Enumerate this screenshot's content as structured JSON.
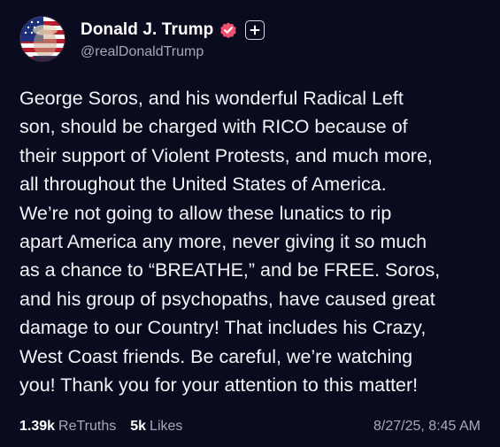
{
  "author": {
    "display_name": "Donald J. Trump",
    "handle": "@realDonaldTrump",
    "verified_color": "#f0506e"
  },
  "post": {
    "lines": [
      "George Soros, and his wonderful Radical Left",
      "son, should be charged with RICO because of",
      "their support of Violent Protests, and much more,",
      "all throughout the United States of America.",
      "We’re not going to allow these lunatics to rip",
      "apart America any more, never giving it so much",
      "as a chance to “BREATHE,” and be FREE. Soros,",
      "and his group of psychopaths, have caused great",
      "damage to our Country! That includes his Crazy,",
      "West Coast friends. Be careful, we’re watching",
      "you! Thank you for your attention to this matter!"
    ]
  },
  "stats": {
    "retruths_count": "1.39k",
    "retruths_label": "ReTruths",
    "likes_count": "5k",
    "likes_label": "Likes"
  },
  "timestamp": "8/27/25, 8:45 AM",
  "icons": {
    "verified": "verified-badge-icon",
    "follow": "plus-icon"
  },
  "colors": {
    "background": "#0b0b1f",
    "text": "#ffffff",
    "muted": "#a8a8b8"
  }
}
